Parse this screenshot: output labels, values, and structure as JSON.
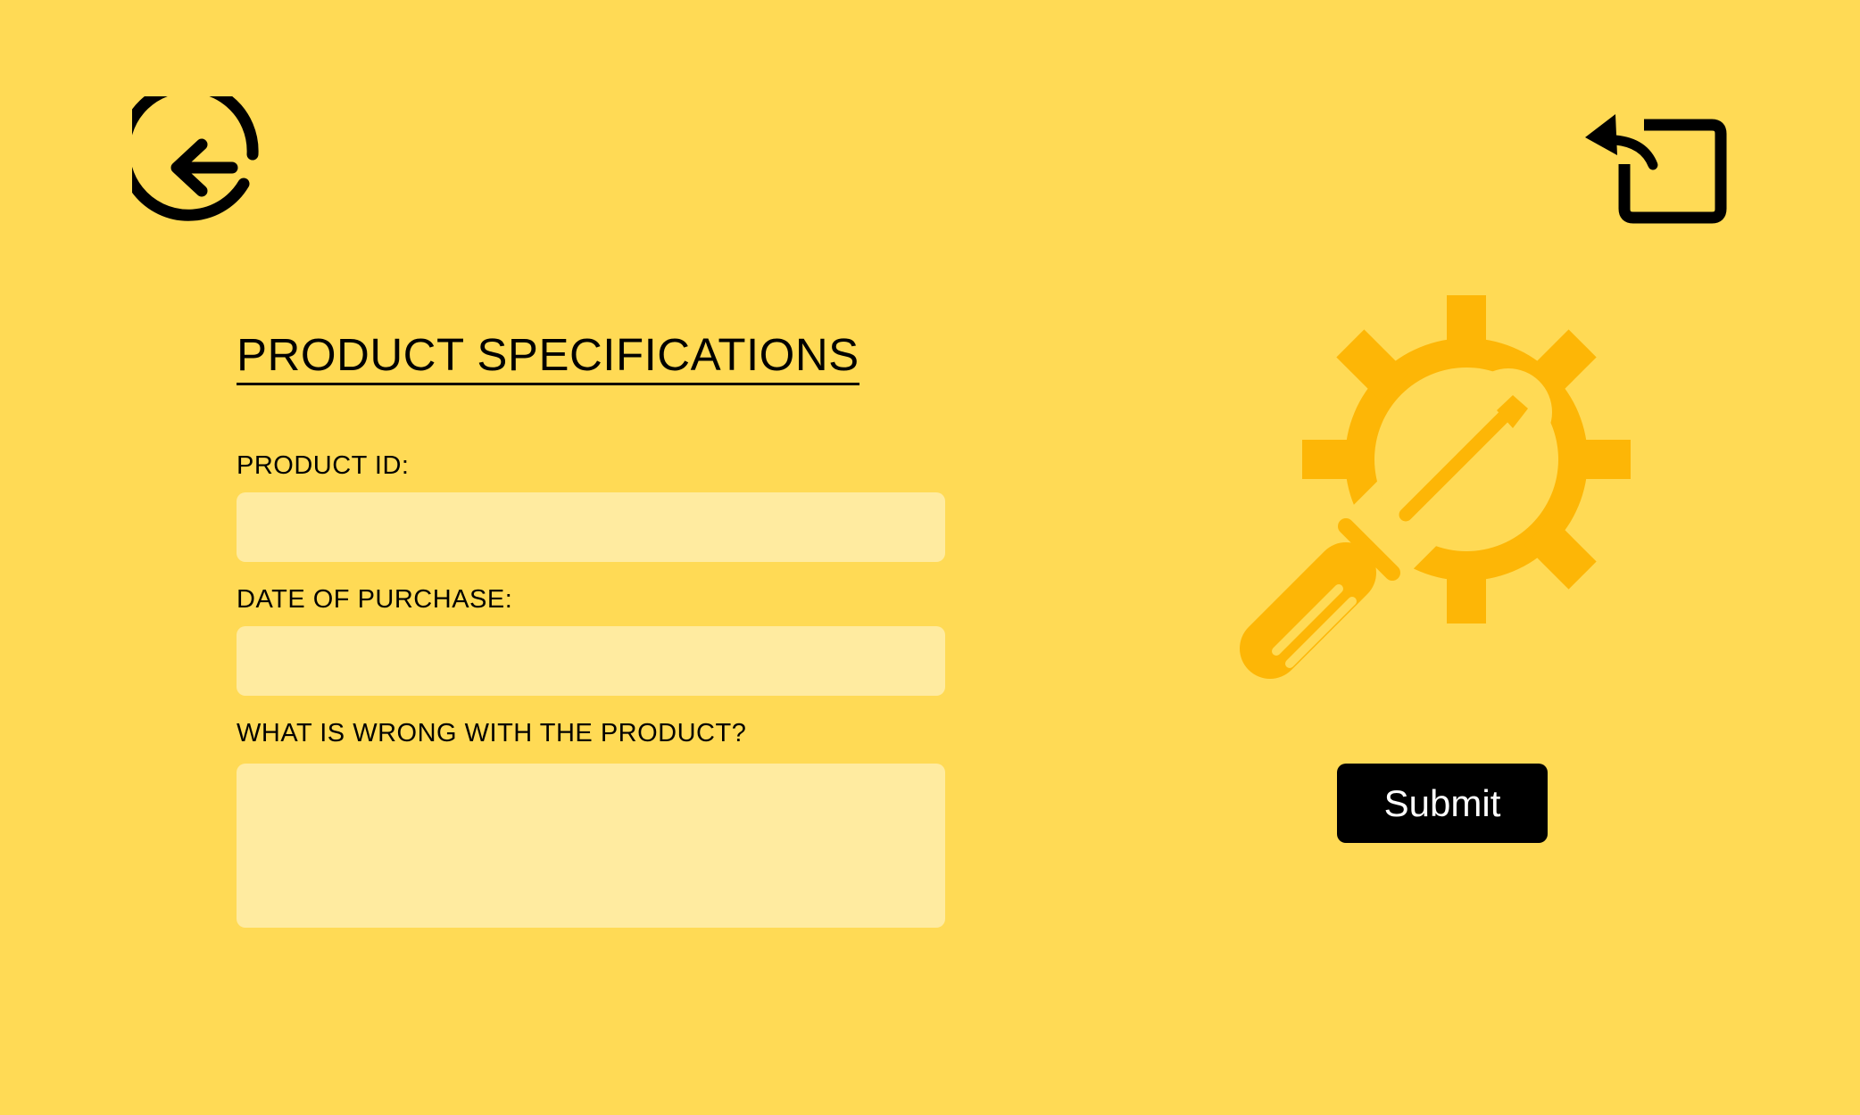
{
  "header": {
    "back_icon": "circular-back-arrow-icon",
    "share_icon": "forward-share-icon"
  },
  "form": {
    "title": "PRODUCT SPECIFICATIONS",
    "fields": [
      {
        "label": "PRODUCT ID:",
        "value": "",
        "placeholder": ""
      },
      {
        "label": "DATE OF PURCHASE:",
        "value": "",
        "placeholder": ""
      },
      {
        "label": "WHAT IS WRONG WITH THE PRODUCT?",
        "value": "",
        "placeholder": ""
      }
    ]
  },
  "illustration": {
    "icon": "gear-screwdriver-icon",
    "color": "#FDB606"
  },
  "submit": {
    "label": "Submit"
  },
  "colors": {
    "background": "#FFDA55",
    "field_fill": "#FFEBA0",
    "text": "#000000",
    "button_bg": "#000000",
    "button_text": "#FFFFFF"
  }
}
